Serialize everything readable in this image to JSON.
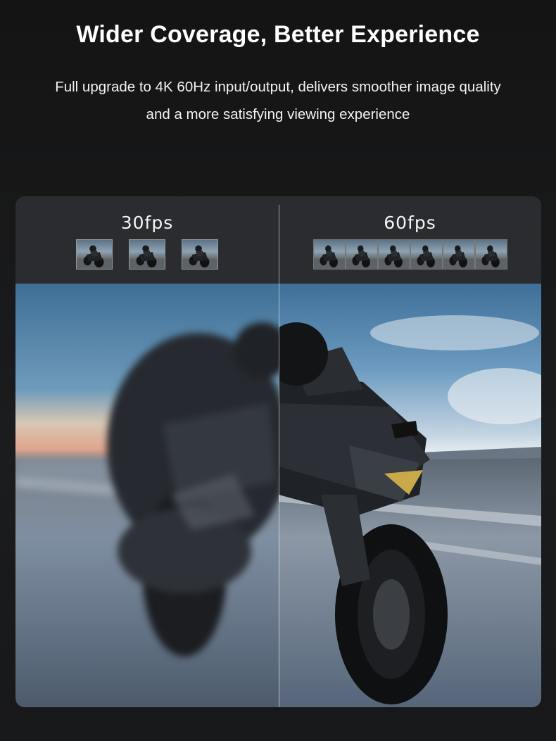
{
  "header": {
    "title": "Wider Coverage, Better Experience",
    "subtitle_line1": "Full upgrade to 4K 60Hz input/output, delivers smoother image quality",
    "subtitle_line2": "and a more satisfying viewing experience"
  },
  "comparison": {
    "left": {
      "label": "30fps",
      "frame_count": 3,
      "image": "motorcycle-blurred"
    },
    "right": {
      "label": "60fps",
      "frame_count": 6,
      "image": "motorcycle-sharp"
    }
  },
  "colors": {
    "background": "#141414",
    "card": "#2a2c30",
    "text": "#ffffff"
  }
}
